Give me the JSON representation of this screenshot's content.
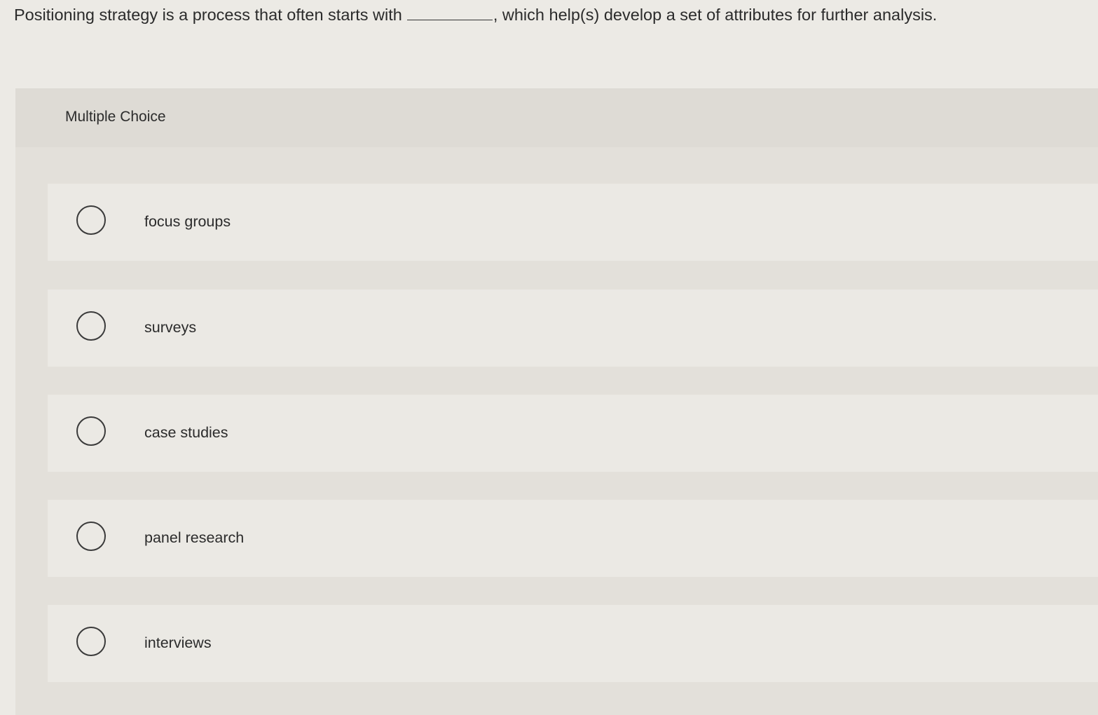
{
  "question": {
    "before_blank": "Positioning strategy is a process that often starts with",
    "after_blank": ", which help(s) develop a set of attributes for further analysis."
  },
  "panel": {
    "title": "Multiple Choice"
  },
  "options": [
    {
      "label": "focus groups",
      "selected": false
    },
    {
      "label": "surveys",
      "selected": false
    },
    {
      "label": "case studies",
      "selected": false
    },
    {
      "label": "panel research",
      "selected": false
    },
    {
      "label": "interviews",
      "selected": false
    }
  ]
}
